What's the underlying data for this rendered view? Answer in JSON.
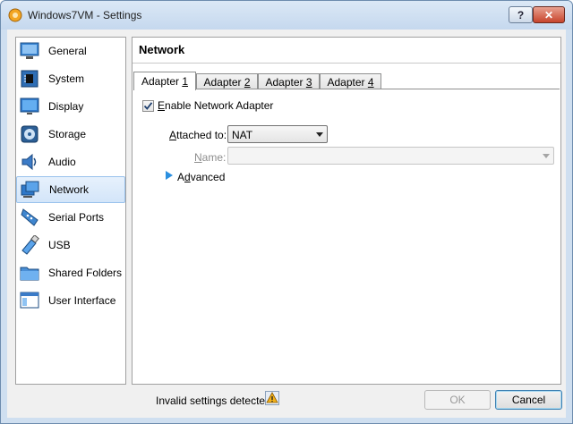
{
  "window": {
    "title": "Windows7VM - Settings",
    "help_label": "?",
    "close_label": "✕"
  },
  "sidebar": {
    "items": [
      {
        "label": "General",
        "icon": "general-icon"
      },
      {
        "label": "System",
        "icon": "system-icon"
      },
      {
        "label": "Display",
        "icon": "display-icon"
      },
      {
        "label": "Storage",
        "icon": "storage-icon"
      },
      {
        "label": "Audio",
        "icon": "audio-icon"
      },
      {
        "label": "Network",
        "icon": "network-icon",
        "selected": true
      },
      {
        "label": "Serial Ports",
        "icon": "serial-ports-icon"
      },
      {
        "label": "USB",
        "icon": "usb-icon"
      },
      {
        "label": "Shared Folders",
        "icon": "shared-folders-icon"
      },
      {
        "label": "User Interface",
        "icon": "user-interface-icon"
      }
    ]
  },
  "panel": {
    "title": "Network",
    "tabs": [
      {
        "label_prefix": "Adapter ",
        "label_key": "1"
      },
      {
        "label_prefix": "Adapter ",
        "label_key": "2"
      },
      {
        "label_prefix": "Adapter ",
        "label_key": "3"
      },
      {
        "label_prefix": "Adapter ",
        "label_key": "4"
      }
    ],
    "active_tab": "Adapter 1",
    "enable_adapter": {
      "key": "E",
      "rest": "nable Network Adapter",
      "checked": true
    },
    "attached_to": {
      "key": "A",
      "rest": "ttached to:",
      "value": "NAT"
    },
    "name": {
      "key": "N",
      "rest": "ame:",
      "value": ""
    },
    "advanced": {
      "prefix": "A",
      "key": "d",
      "rest": "vanced"
    }
  },
  "footer": {
    "status": "Invalid settings detected",
    "ok_label": "OK",
    "cancel_label": "Cancel"
  },
  "colors": {
    "accent": "#3c7fb1",
    "selection": "#d3e5f9"
  }
}
